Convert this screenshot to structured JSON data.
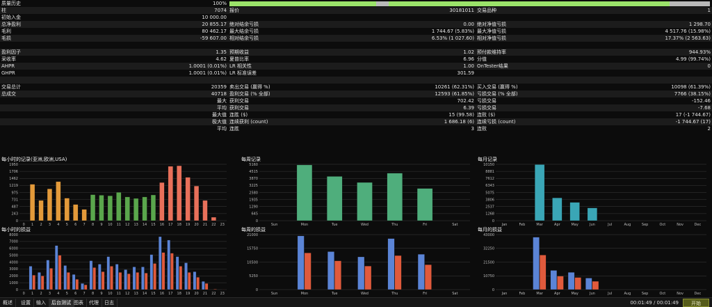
{
  "stats": {
    "quality": {
      "label": "质量历史",
      "value": "100%",
      "percent": 100,
      "segments": [
        [
          0,
          30.5,
          "#9be36a"
        ],
        [
          33.1,
          91.6,
          "#9be36a"
        ]
      ]
    },
    "rows": [
      [
        "柱",
        "7074",
        "报价",
        "30181011",
        "交易品种",
        "1"
      ],
      [
        "初始入金",
        "10 000.00",
        "",
        "",
        "",
        ""
      ],
      [
        "总净盈利",
        "20 855.17",
        "绝对结余亏损",
        "0.00",
        "绝对净值亏损",
        "1 298.70"
      ],
      [
        "毛利",
        "80 462.17",
        "最大结余亏损",
        "1 744.67 (5.83%)",
        "最大净值亏损",
        "4 517.76 (15.98%)"
      ],
      [
        "毛损",
        "-59 607.00",
        "相对结余亏损",
        "6.53% (1 027.60)",
        "相对净值亏损",
        "17.37% (2 563.63)"
      ],
      [
        "",
        "",
        "",
        "",
        "",
        ""
      ],
      [
        "盈利因子",
        "1.35",
        "预期收益",
        "1.02",
        "预付款维持率",
        "944.93%"
      ],
      [
        "采收率",
        "4.62",
        "夏普比率",
        "6.96",
        "分值",
        "4.99 (99.74%)"
      ],
      [
        "AHPR",
        "1.0001 (0.01%)",
        "LR 相关性",
        "1.00",
        "OnTester结果",
        "0"
      ],
      [
        "GHPR",
        "1.0001 (0.01%)",
        "LR 标准误差",
        "301.59",
        "",
        ""
      ],
      [
        "",
        "",
        "",
        "",
        "",
        ""
      ],
      [
        "交易总计",
        "20359",
        "卖出交易 (赢得 %)",
        "10261 (62.31%)",
        "买入交易 (赢得 %)",
        "10098 (61.39%)"
      ],
      [
        "总成交",
        "40718",
        "盈利交易 (% 全部)",
        "12593 (61.85%)",
        "亏损交易 (% 全部)",
        "7766 (38.15%)"
      ],
      [
        "",
        "最大",
        "获利交易",
        "702.42",
        "亏损交易",
        "-152.46"
      ],
      [
        "",
        "平均",
        "获利交易",
        "6.39",
        "亏损交易",
        "-7.68"
      ],
      [
        "",
        "最大值",
        "连胜 ($)",
        "15 (99.58)",
        "连败 ($)",
        "17 (-1 744.67)"
      ],
      [
        "",
        "极大值",
        "连续获利 (count)",
        "1 686.18 (6)",
        "连续亏损 (count)",
        "-1 744.67 (17)"
      ],
      [
        "",
        "平均",
        "连胜",
        "3",
        "连败",
        "2"
      ]
    ]
  },
  "charts": {
    "hourly_count": {
      "title": "每小时的记录(亚洲,欧洲,USA)",
      "type": "bar",
      "yticks": [
        "1950",
        "1706",
        "1462",
        "1219",
        "975",
        "731",
        "487",
        "243",
        "0"
      ],
      "ymax": 1950,
      "categories": [
        "0",
        "1",
        "2",
        "3",
        "4",
        "5",
        "6",
        "7",
        "8",
        "9",
        "10",
        "11",
        "12",
        "13",
        "14",
        "15",
        "16",
        "17",
        "18",
        "19",
        "20",
        "21",
        "22",
        "23"
      ],
      "values": [
        0,
        1260,
        700,
        1100,
        1350,
        780,
        560,
        390,
        900,
        880,
        860,
        980,
        820,
        770,
        820,
        890,
        1320,
        1880,
        1900,
        1500,
        1200,
        700,
        120,
        0
      ],
      "colors": [
        "#e39a3a",
        "#e39a3a",
        "#e39a3a",
        "#e39a3a",
        "#e39a3a",
        "#e39a3a",
        "#e39a3a",
        "#e39a3a",
        "#5aa64c",
        "#5aa64c",
        "#5aa64c",
        "#5aa64c",
        "#5aa64c",
        "#5aa64c",
        "#5aa64c",
        "#5aa64c",
        "#e8705a",
        "#e8705a",
        "#e8705a",
        "#e8705a",
        "#e8705a",
        "#e8705a",
        "#e8705a",
        "#e8705a"
      ]
    },
    "weekly_count": {
      "title": "每周记录",
      "type": "bar",
      "yticks": [
        "5160",
        "4515",
        "3870",
        "3225",
        "2580",
        "1935",
        "1290",
        "645",
        "0"
      ],
      "ymax": 5160,
      "categories": [
        "Sun",
        "Mon",
        "Tue",
        "Wed",
        "Thu",
        "Fri",
        "Sat"
      ],
      "values": [
        0,
        5100,
        4050,
        3500,
        4350,
        2950,
        0
      ],
      "color": "#4fae7c"
    },
    "monthly_count": {
      "title": "每月记录",
      "type": "bar",
      "yticks": [
        "10150",
        "8881",
        "7612",
        "6343",
        "5075",
        "3806",
        "2537",
        "1268",
        "0"
      ],
      "ymax": 10150,
      "categories": [
        "Jan",
        "Feb",
        "Mar",
        "Apr",
        "May",
        "Jun",
        "Jul",
        "Aug",
        "Sep",
        "Oct",
        "Nov",
        "Dec"
      ],
      "values": [
        0,
        0,
        10100,
        4100,
        3300,
        2300,
        0,
        0,
        0,
        0,
        0,
        0
      ],
      "color": "#3aa6b6"
    },
    "hourly_pl": {
      "title": "每小时的损益",
      "type": "bar",
      "yticks": [
        "8000",
        "7000",
        "6000",
        "5000",
        "4000",
        "3000",
        "2000",
        "1000",
        "0"
      ],
      "ymax": 8000,
      "categories": [
        "0",
        "1",
        "2",
        "3",
        "4",
        "5",
        "6",
        "7",
        "8",
        "9",
        "10",
        "11",
        "12",
        "13",
        "14",
        "15",
        "16",
        "17",
        "18",
        "19",
        "20",
        "21",
        "22",
        "23"
      ],
      "series": [
        {
          "name": "",
          "color": "#5b84d6",
          "values": [
            0,
            3400,
            2500,
            4300,
            6400,
            3500,
            2200,
            900,
            4200,
            3700,
            4800,
            3700,
            2900,
            3300,
            3300,
            5100,
            7700,
            7200,
            4800,
            3900,
            2600,
            1200,
            0,
            0
          ]
        },
        {
          "name": "",
          "color": "#e05a3c",
          "values": [
            0,
            2100,
            2000,
            3100,
            5000,
            2500,
            1500,
            700,
            3200,
            2600,
            3400,
            2500,
            2300,
            2500,
            2400,
            3800,
            5400,
            5300,
            3400,
            2500,
            1800,
            900,
            80,
            40
          ]
        }
      ]
    },
    "weekly_pl": {
      "title": "每周的损益",
      "type": "bar",
      "yticks": [
        "21000",
        "15750",
        "10500",
        "5250",
        "0"
      ],
      "ymax": 21000,
      "categories": [
        "Sun",
        "Mon",
        "Tue",
        "Wed",
        "Thu",
        "Fri",
        "Sat"
      ],
      "series": [
        {
          "name": "",
          "color": "#5b84d6",
          "values": [
            0,
            20500,
            14500,
            12500,
            19500,
            13500,
            0
          ]
        },
        {
          "name": "",
          "color": "#e05a3c",
          "values": [
            0,
            14000,
            11000,
            9000,
            13000,
            9500,
            0
          ]
        }
      ]
    },
    "monthly_pl": {
      "title": "每月的损益",
      "type": "bar",
      "yticks": [
        "43000",
        "32250",
        "21500",
        "10750",
        "0"
      ],
      "ymax": 43000,
      "categories": [
        "Jan",
        "Feb",
        "Mar",
        "Apr",
        "May",
        "Jun",
        "Jul",
        "Aug",
        "Sep",
        "Oct",
        "Nov",
        "Dec"
      ],
      "series": [
        {
          "name": "",
          "color": "#5b84d6",
          "values": [
            0,
            0,
            41000,
            15000,
            13500,
            9000,
            0,
            0,
            0,
            0,
            0,
            0
          ]
        },
        {
          "name": "",
          "color": "#e05a3c",
          "values": [
            0,
            0,
            27000,
            10500,
            9500,
            6500,
            0,
            0,
            0,
            0,
            0,
            0
          ]
        }
      ]
    }
  },
  "tabs": [
    "概述",
    "设置",
    "输入",
    "后台测试",
    "图表",
    "代理",
    "日志"
  ],
  "active_tab": 3,
  "timer": "00:01:49 / 00:01:49",
  "start_button": "开始"
}
